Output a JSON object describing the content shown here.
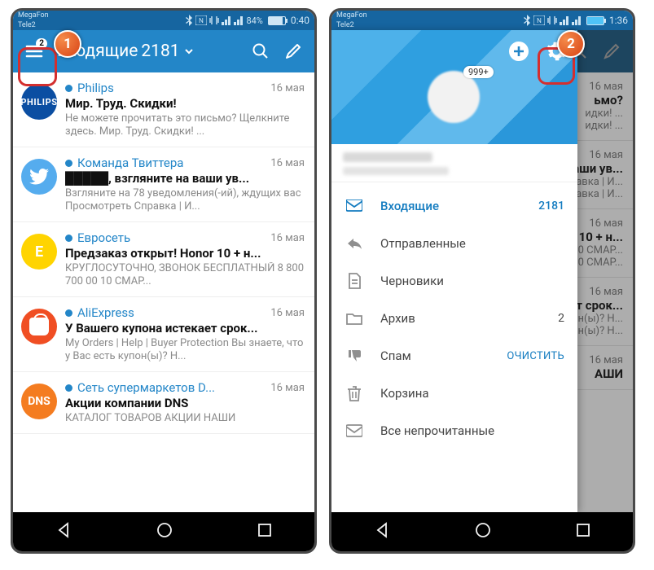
{
  "left": {
    "statusbar": {
      "carrier1": "MegaFon",
      "carrier2": "Tele2",
      "battery_pct": "84%",
      "time": "0:40"
    },
    "appbar": {
      "menu_badge": "2",
      "title_prefix": "Входящие",
      "title_count": "2181"
    },
    "emails": [
      {
        "sender": "Philips",
        "date": "16 мая",
        "subject": "Мир. Труд. Скидки!",
        "snippet": "Не можете прочитать это письмо? Щелкните здесь. Мир. Труд. Скидки! ...",
        "avatar": "philips",
        "avtext": "PHILIPS"
      },
      {
        "sender": "Команда Твиттера",
        "date": "16 мая",
        "subject": "█████, взгляните на ваши ув...",
        "snippet": "Взгляните на 78 уведомления(-ий), ждущих вас Просмотреть Справка | И...",
        "avatar": "twitter",
        "avtext": ""
      },
      {
        "sender": "Евросеть",
        "date": "16 мая",
        "subject": "Предзаказ открыт! Honor 10 + н...",
        "snippet": "КРУГЛОСУТОЧНО, ЗВОНОК БЕСПЛАТНЫЙ 8 800 700 00 10 СМАР...",
        "avatar": "euroset",
        "avtext": "Е"
      },
      {
        "sender": "AliExpress",
        "date": "16 мая",
        "subject": "У Вашего купона истекает срок...",
        "snippet": "My Orders | Help | Buyer Protection Вы знаете, что у Вас есть купон(ы)? Н...",
        "avatar": "ali",
        "avtext": ""
      },
      {
        "sender": "Сеть супермаркетов D...",
        "date": "16 мая",
        "subject": "Акции компании DNS",
        "snippet": "КАТАЛОГ ТОВАРОВ АКЦИИ НАШИ",
        "avatar": "dns",
        "avtext": "DNS"
      }
    ]
  },
  "right": {
    "statusbar": {
      "carrier1": "MegaFon",
      "carrier2": "Tele2",
      "time": "1:36"
    },
    "profile_badge": "999+",
    "folders": [
      {
        "icon": "inbox",
        "label": "Входящие",
        "count": "2181",
        "active": true
      },
      {
        "icon": "sent",
        "label": "Отправленные"
      },
      {
        "icon": "drafts",
        "label": "Черновики"
      },
      {
        "icon": "archive",
        "label": "Архив",
        "count": "2"
      },
      {
        "icon": "spam",
        "label": "Спам",
        "action": "ОЧИСТИТЬ"
      },
      {
        "icon": "trash",
        "label": "Корзина"
      },
      {
        "icon": "unread",
        "label": "Все непрочитанные"
      }
    ],
    "bg": [
      {
        "d": "16 мая",
        "s": "ьмо?",
        "p": "идки! ..."
      },
      {
        "d": "16 мая",
        "s": "наши ув...",
        "p": "а(-ий), авка | И..."
      },
      {
        "d": "16 мая",
        "s": "10 + н...",
        "p": "0 СМАР..."
      },
      {
        "d": "16 мая",
        "s": "ет срок...",
        "p": "н(ы)? Н..."
      },
      {
        "d": "16 мая",
        "s": "АШИ",
        "p": ""
      }
    ]
  },
  "callouts": {
    "num1": "1",
    "num2": "2"
  }
}
